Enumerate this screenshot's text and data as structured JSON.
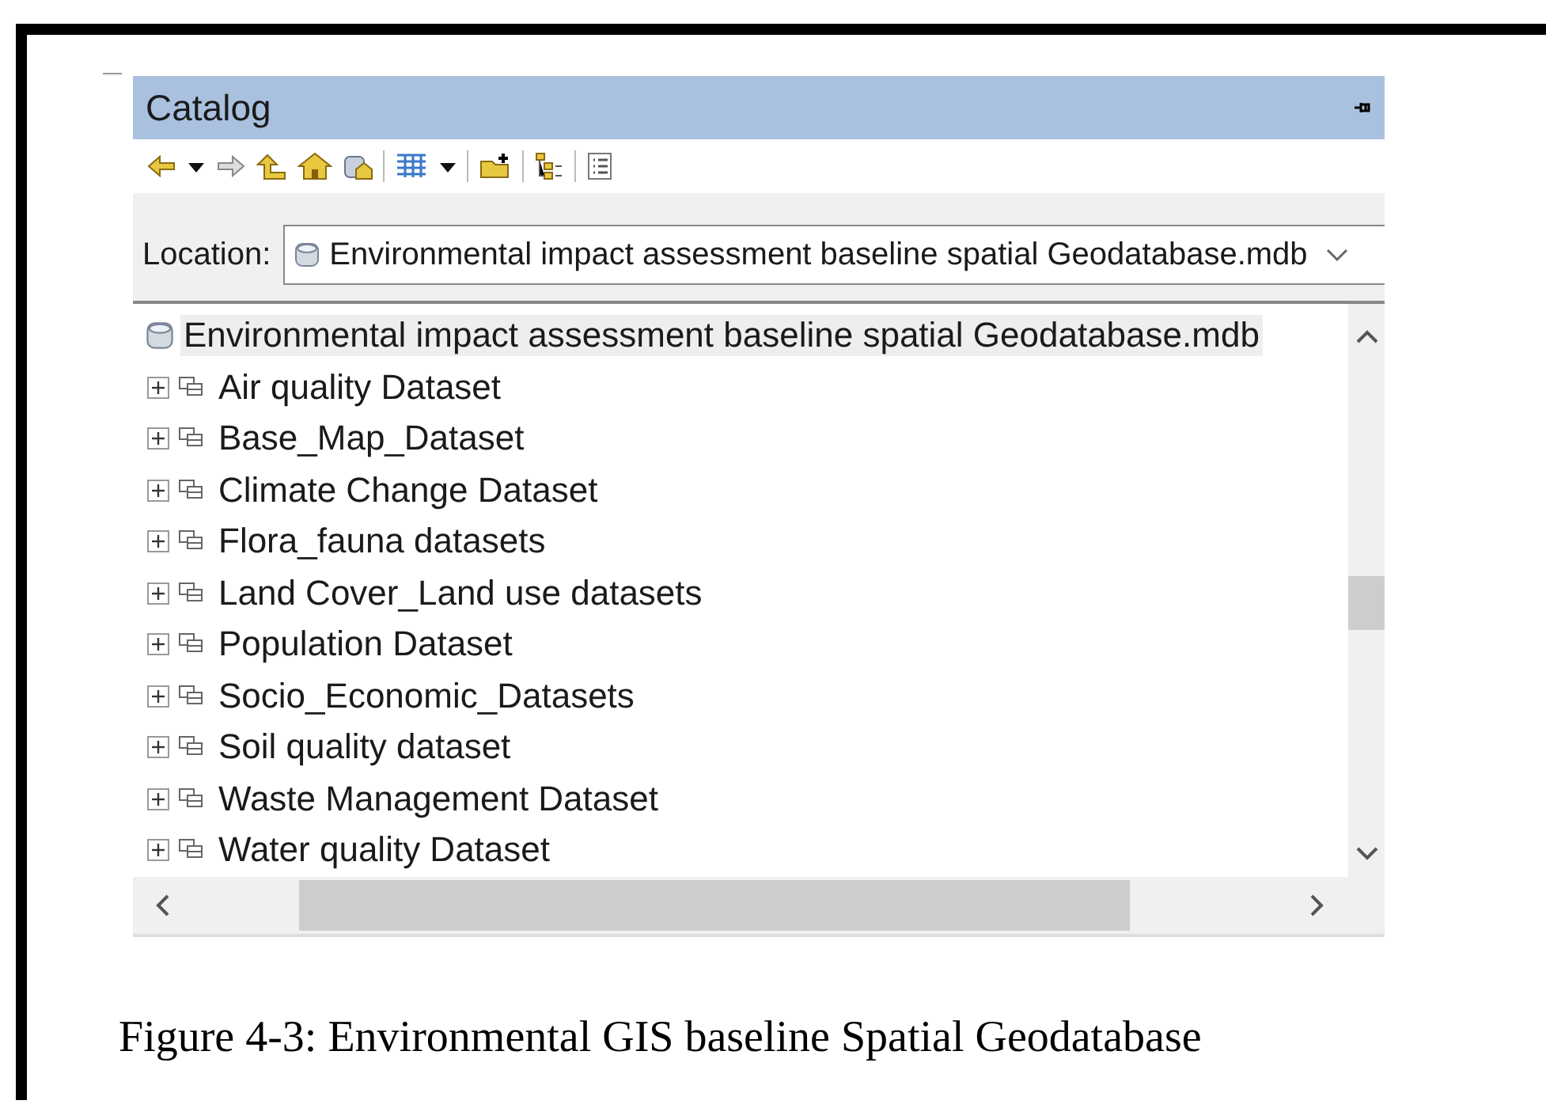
{
  "catalog": {
    "title": "Catalog",
    "location": {
      "label": "Location:",
      "value": "Environmental impact assessment baseline spatial Geodatabase.mdb"
    },
    "tree": {
      "label": "Environmental impact assessment baseline spatial Geodatabase.mdb",
      "selected": true,
      "children": [
        {
          "label": "Air quality Dataset",
          "expanded": false
        },
        {
          "label": "Base_Map_Dataset",
          "expanded": false
        },
        {
          "label": "Climate Change Dataset",
          "expanded": false
        },
        {
          "label": "Flora_fauna datasets",
          "expanded": false
        },
        {
          "label": "Land Cover_Land use datasets",
          "expanded": false
        },
        {
          "label": "Population Dataset",
          "expanded": false
        },
        {
          "label": "Socio_Economic_Datasets",
          "expanded": false
        },
        {
          "label": "Soil quality dataset",
          "expanded": false
        },
        {
          "label": "Waste Management Dataset",
          "expanded": false
        },
        {
          "label": "Water quality Dataset",
          "expanded": false
        }
      ]
    }
  },
  "caption": "Figure 4-3: Environmental GIS baseline Spatial Geodatabase"
}
